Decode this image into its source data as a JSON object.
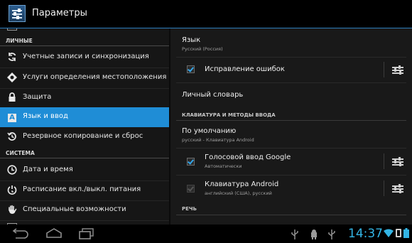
{
  "header": {
    "title": "Параметры",
    "app_icon": "settings-icon"
  },
  "sidebar": {
    "sections": [
      {
        "label": "ЛИЧНЫЕ"
      },
      {
        "label": "СИСТЕМА"
      }
    ],
    "items": [
      {
        "label": "Учетные записи и синхронизация",
        "icon": "sync-icon"
      },
      {
        "label": "Услуги определения местоположения",
        "icon": "location-icon"
      },
      {
        "label": "Защита",
        "icon": "lock-icon"
      },
      {
        "label": "Язык и ввод",
        "icon": "language-icon",
        "active": true
      },
      {
        "label": "Резервное копирование и сброс",
        "icon": "backup-icon"
      },
      {
        "label": "Дата и время",
        "icon": "clock-icon"
      },
      {
        "label": "Расписание вкл./выкл. питания",
        "icon": "power-schedule-icon"
      },
      {
        "label": "Специальные возможности",
        "icon": "hand-icon"
      }
    ]
  },
  "main": {
    "language": {
      "title": "Язык",
      "value": "Русский (Россия)"
    },
    "spellcheck": {
      "title": "Исправление ошибок",
      "checked": true
    },
    "dictionary": {
      "title": "Личный словарь"
    },
    "keyboard_section": "КЛАВИАТУРА И МЕТОДЫ ВВОДА",
    "default": {
      "title": "По умолчанию",
      "value": "русский - Клавиатура Android"
    },
    "google_voice": {
      "title": "Голосовой ввод Google",
      "sub": "Автоматически",
      "checked": true
    },
    "android_kb": {
      "title": "Клавиатура Android",
      "sub": "английский (США), русский",
      "checked": true,
      "disabled": true
    },
    "speech_section": "РЕЧЬ"
  },
  "statusbar": {
    "time": "14:37"
  },
  "colors": {
    "accent": "#1f8dd6",
    "clock": "#33b5e5",
    "background": "#111111"
  }
}
